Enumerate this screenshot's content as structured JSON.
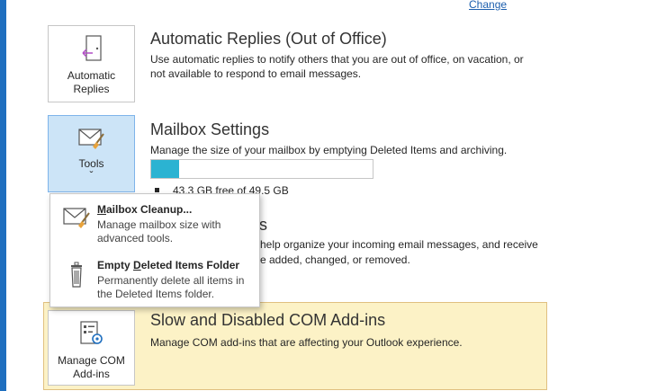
{
  "header": {
    "change_link": "Change"
  },
  "automatic_replies": {
    "tile_label_line1": "Automatic",
    "tile_label_line2": "Replies",
    "title": "Automatic Replies (Out of Office)",
    "description": "Use automatic replies to notify others that you are out of office, on vacation, or not available to respond to email messages."
  },
  "mailbox_settings": {
    "tile_label": "Tools",
    "tile_chevron": "ˇ",
    "title": "Mailbox Settings",
    "description": "Manage the size of your mailbox by emptying Deleted Items and archiving.",
    "storage_text": "43.3 GB free of 49.5 GB",
    "usage_fraction": 0.125,
    "fill_color": "#2bb3d2"
  },
  "rules_section_partial": {
    "title_fragment": "s",
    "desc_fragment_1": "help organize your incoming email messages, and receive",
    "desc_fragment_2": "e added, changed, or removed."
  },
  "tools_menu": {
    "items": [
      {
        "title_underlined": "M",
        "title_rest": "ailbox Cleanup...",
        "description": "Manage mailbox size with advanced tools."
      },
      {
        "title_prefix": "Empty ",
        "title_underlined": "D",
        "title_rest": "eleted Items Folder",
        "description": "Permanently delete all items in the Deleted Items folder."
      }
    ]
  },
  "com_addins": {
    "tile_label_line1": "Manage COM",
    "tile_label_line2": "Add-ins",
    "title": "Slow and Disabled COM Add-ins",
    "description": "Manage COM add-ins that are affecting your Outlook experience.",
    "highlight_color": "#fcf2c6"
  }
}
